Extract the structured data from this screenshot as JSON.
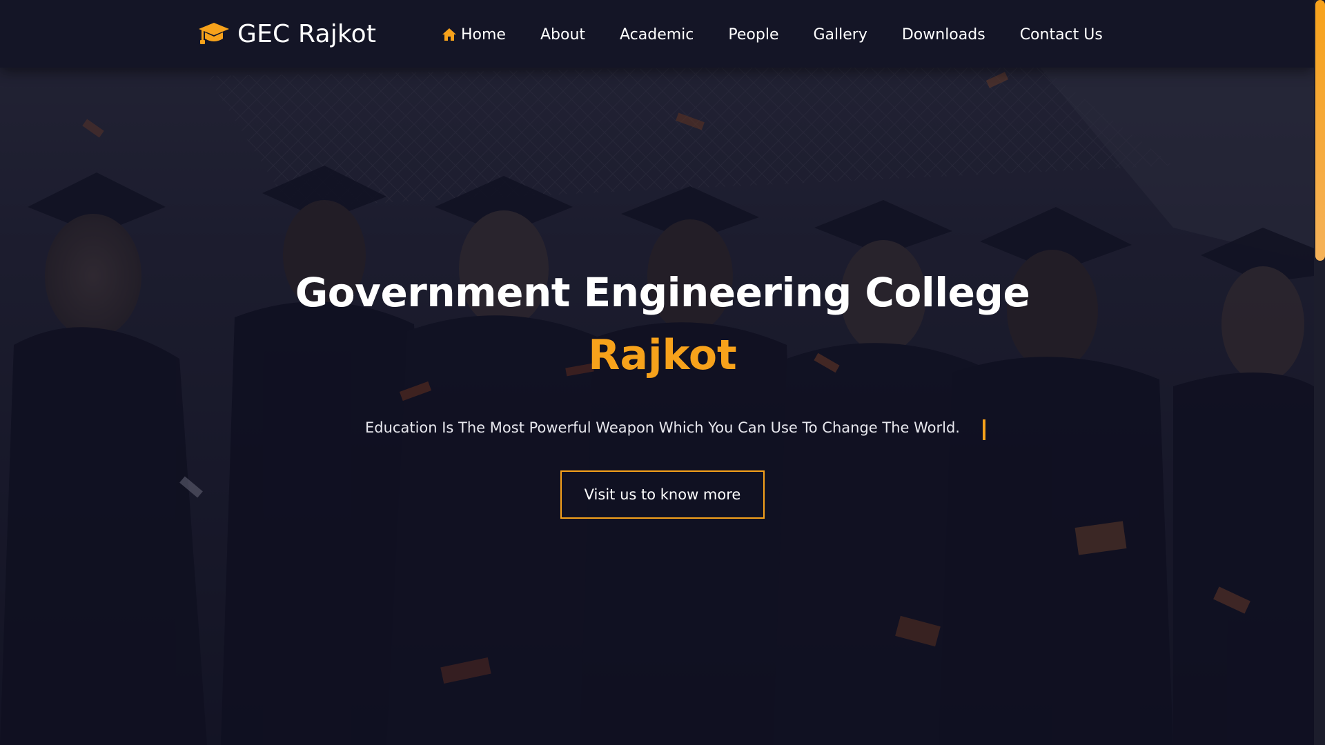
{
  "brand": {
    "name": "GEC Rajkot",
    "icon": "graduation-cap-icon"
  },
  "nav": {
    "items": [
      {
        "label": "Home",
        "icon": "home-icon",
        "active": true
      },
      {
        "label": "About"
      },
      {
        "label": "Academic"
      },
      {
        "label": "People"
      },
      {
        "label": "Gallery"
      },
      {
        "label": "Downloads"
      },
      {
        "label": "Contact Us"
      }
    ]
  },
  "hero": {
    "title": "Government Engineering College",
    "title_accent": "Rajkot",
    "tagline": "Education Is The Most Powerful Weapon Which You Can Use To Change The World.",
    "cta_label": "Visit us to know more",
    "background": "graduation-celebration-photo"
  },
  "colors": {
    "accent": "#f7a21b",
    "navbar": "#141526",
    "text": "#ffffff"
  }
}
